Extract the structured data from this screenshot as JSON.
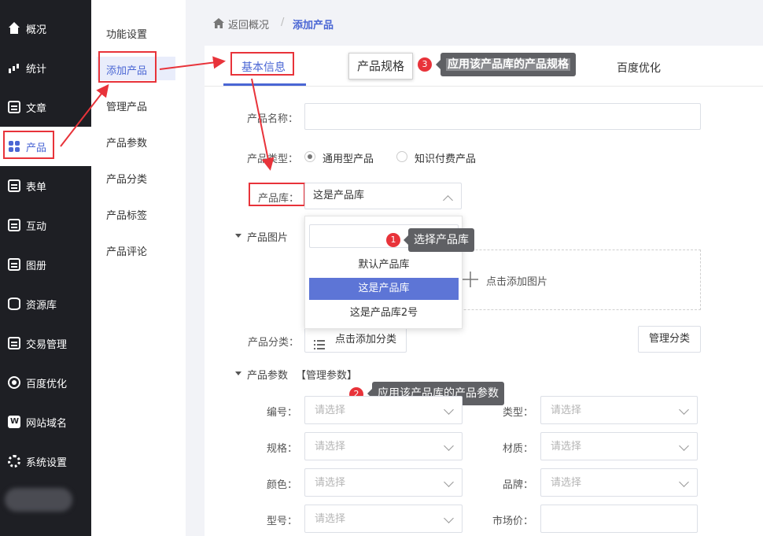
{
  "nav": {
    "items": [
      {
        "label": "概况",
        "icon": "home-icon"
      },
      {
        "label": "统计",
        "icon": "chart-icon"
      },
      {
        "label": "文章",
        "icon": "article-icon"
      },
      {
        "label": "产品",
        "icon": "product-grid-icon"
      },
      {
        "label": "表单",
        "icon": "form-icon"
      },
      {
        "label": "互动",
        "icon": "chat-icon"
      },
      {
        "label": "图册",
        "icon": "album-icon"
      },
      {
        "label": "资源库",
        "icon": "database-icon"
      },
      {
        "label": "交易管理",
        "icon": "trade-icon"
      },
      {
        "label": "百度优化",
        "icon": "seo-icon"
      },
      {
        "label": "网站域名",
        "icon": "domain-w-icon"
      },
      {
        "label": "系统设置",
        "icon": "gear-icon"
      }
    ],
    "active": "产品"
  },
  "subnav": {
    "items": [
      "功能设置",
      "添加产品",
      "管理产品",
      "产品参数",
      "产品分类",
      "产品标签",
      "产品评论"
    ],
    "active": "添加产品"
  },
  "breadcrumb": {
    "back": "返回概况",
    "separator": "/",
    "current": "添加产品"
  },
  "tabs": {
    "basic": "基本信息",
    "spec": "产品规格",
    "seo": "百度优化"
  },
  "annotations": {
    "a1": {
      "num": "1",
      "text": "选择产品库"
    },
    "a2": {
      "num": "2",
      "text": "应用该产品库的产品参数"
    },
    "a3": {
      "num": "3",
      "text": "应用该产品库的产品规格"
    }
  },
  "form": {
    "name_label": "产品名称：",
    "name_value": "",
    "type_label": "产品类型：",
    "type_options": [
      "通用型产品",
      "知识付费产品"
    ],
    "type_selected": "通用型产品",
    "library_label": "产品库：",
    "library_value": "这是产品库",
    "images_label": "产品图片",
    "add_image": "点击添加图片",
    "category_label": "产品分类：",
    "add_category": "点击添加分类",
    "manage_category": "管理分类",
    "params_label": "产品参数",
    "manage_params": "【管理参数】",
    "select_placeholder": "请选择",
    "params": [
      {
        "label": "编号：",
        "kind": "select"
      },
      {
        "label": "类型：",
        "kind": "select"
      },
      {
        "label": "规格：",
        "kind": "select"
      },
      {
        "label": "材质：",
        "kind": "select"
      },
      {
        "label": "颜色：",
        "kind": "select"
      },
      {
        "label": "品牌：",
        "kind": "select"
      },
      {
        "label": "型号：",
        "kind": "select"
      },
      {
        "label": "市场价：",
        "kind": "input"
      }
    ]
  },
  "dropdown": {
    "search_value": "",
    "options": [
      "默认产品库",
      "这是产品库",
      "这是产品库2号"
    ],
    "selected": "这是产品库"
  },
  "colors": {
    "accent": "#4a66d4",
    "nav_bg": "#1e1f24",
    "annotation_red": "#e8333a",
    "selected_option": "#5d75d6"
  }
}
